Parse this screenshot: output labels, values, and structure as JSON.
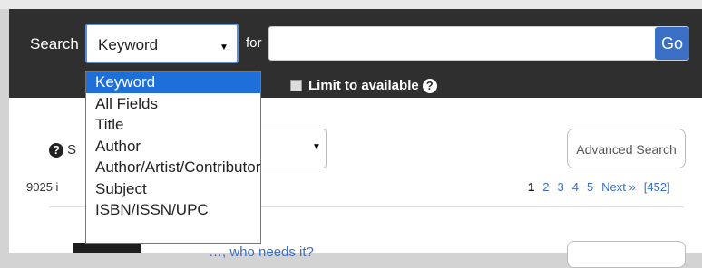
{
  "search": {
    "label": "Search",
    "selected_field": "Keyword",
    "for_label": "for",
    "query_value": "",
    "go_label": "Go",
    "limit_label": "Limit to available",
    "field_options": [
      "Keyword",
      "All Fields",
      "Title",
      "Author",
      "Author/Artist/Contributor",
      "Subject",
      "ISBN/ISSN/UPC"
    ]
  },
  "results": {
    "sort_label_visible": "S",
    "count_text_visible": "9025 i",
    "advanced_search_label": "Advanced Search",
    "pagination": [
      "1",
      "2",
      "3",
      "4",
      "5",
      "Next »",
      "[452]"
    ],
    "first_result_title_visible": "…, who needs it?"
  },
  "colors": {
    "search_bar_bg": "#2f2f2f",
    "accent": "#3a6fc6",
    "dropdown_highlight": "#1e6fd9"
  }
}
